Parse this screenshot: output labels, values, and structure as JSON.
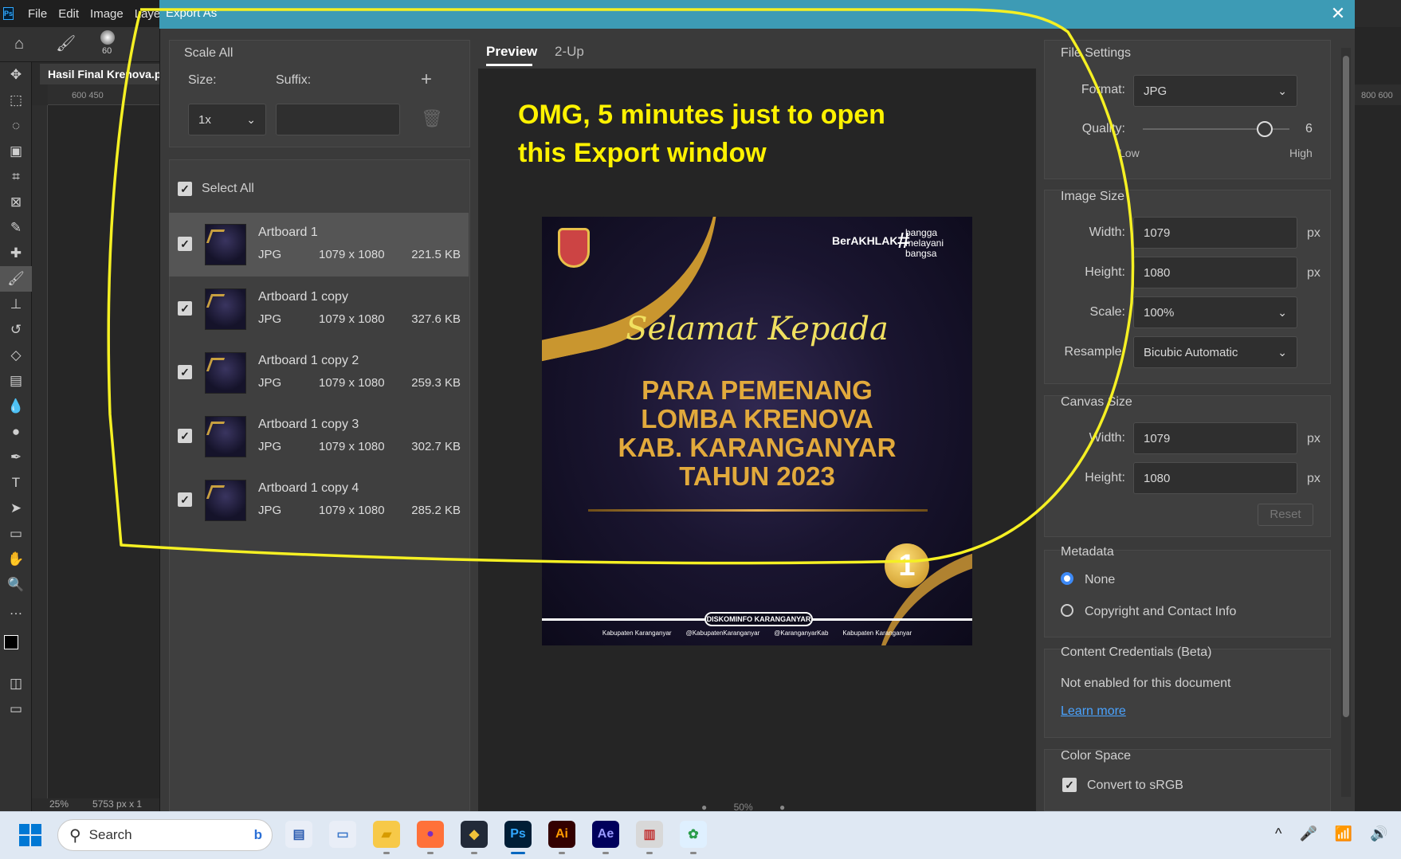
{
  "ps": {
    "logo": "Ps",
    "menu": [
      "File",
      "Edit",
      "Image",
      "Laye"
    ],
    "brush_size": "60",
    "doc_tab": "Hasil Final Krenova.ps",
    "ruler_top": "600      450",
    "ruler_right": "800  600",
    "status_zoom": "25%",
    "status_dims": "5753 px x 1"
  },
  "dialog": {
    "title": "Export As",
    "close_icon": "close-icon"
  },
  "scale": {
    "title": "Scale All",
    "size_label": "Size:",
    "suffix_label": "Suffix:",
    "size_value": "1x",
    "suffix_value": "",
    "add_icon": "plus-icon",
    "delete_icon": "trash-icon"
  },
  "assets": {
    "select_all": "Select All",
    "rows": [
      {
        "name": "Artboard 1",
        "format": "JPG",
        "dims": "1079 x 1080",
        "size": "221.5 KB",
        "selected": true
      },
      {
        "name": "Artboard 1 copy",
        "format": "JPG",
        "dims": "1079 x 1080",
        "size": "327.6 KB",
        "selected": false
      },
      {
        "name": "Artboard 1 copy 2",
        "format": "JPG",
        "dims": "1079 x 1080",
        "size": "259.3 KB",
        "selected": false
      },
      {
        "name": "Artboard 1 copy 3",
        "format": "JPG",
        "dims": "1079 x 1080",
        "size": "302.7 KB",
        "selected": false
      },
      {
        "name": "Artboard 1 copy 4",
        "format": "JPG",
        "dims": "1079 x 1080",
        "size": "285.2 KB",
        "selected": false
      }
    ]
  },
  "preview": {
    "tabs": [
      "Preview",
      "2-Up"
    ],
    "annotation": "OMG, 5 minutes just to open this Export window",
    "zoom": "50%"
  },
  "poster": {
    "berakhlak": "BerAKHLAK",
    "hash": "#",
    "bangga": "bangga melayani bangsa",
    "script": "Selamat Kepada",
    "headline": [
      "PARA PEMENANG",
      "LOMBA KRENOVA",
      "KAB. KARANGANYAR",
      "TAHUN 2023"
    ],
    "medal": "1",
    "badge": "DISKOMINFO KARANGANYAR",
    "socials": [
      "Kabupaten Karanganyar",
      "@KabupatenKaranganyar",
      "@KaranganyarKab",
      "Kabupaten Karanganyar"
    ]
  },
  "file_settings": {
    "title": "File Settings",
    "format_label": "Format:",
    "format_value": "JPG",
    "quality_label": "Quality:",
    "quality_value": "6",
    "quality_fraction": 0.83,
    "low": "Low",
    "high": "High"
  },
  "image_size": {
    "title": "Image Size",
    "width_label": "Width:",
    "width_value": "1079",
    "height_label": "Height:",
    "height_value": "1080",
    "scale_label": "Scale:",
    "scale_value": "100%",
    "resample_label": "Resample:",
    "resample_value": "Bicubic Automatic",
    "unit": "px"
  },
  "canvas_size": {
    "title": "Canvas Size",
    "width_label": "Width:",
    "width_value": "1079",
    "height_label": "Height:",
    "height_value": "1080",
    "unit": "px",
    "reset": "Reset"
  },
  "metadata": {
    "title": "Metadata",
    "none": "None",
    "copyright": "Copyright and Contact Info"
  },
  "credentials": {
    "title": "Content Credentials (Beta)",
    "text": "Not enabled for this document",
    "link": "Learn more"
  },
  "color_space": {
    "title": "Color Space",
    "convert": "Convert to sRGB"
  },
  "taskbar": {
    "search": "Search",
    "apps": [
      {
        "name": "explorer-doc-icon",
        "glyph": "▤",
        "bg": "#e9eef7",
        "fg": "#2a5bb0"
      },
      {
        "name": "photos-icon",
        "glyph": "▭",
        "bg": "#e9eef7",
        "fg": "#3a77c9"
      },
      {
        "name": "file-explorer-icon",
        "glyph": "▰",
        "bg": "#f7c948",
        "fg": "#d79b00"
      },
      {
        "name": "firefox-icon",
        "glyph": "●",
        "bg": "#ff7139",
        "fg": "#7b2cbf"
      },
      {
        "name": "davinci-icon",
        "glyph": "◆",
        "bg": "#222a38",
        "fg": "#f0c23a"
      },
      {
        "name": "photoshop-icon",
        "glyph": "Ps",
        "bg": "#001e36",
        "fg": "#31a8ff"
      },
      {
        "name": "illustrator-icon",
        "glyph": "Ai",
        "bg": "#330000",
        "fg": "#ff9a00"
      },
      {
        "name": "after-effects-icon",
        "glyph": "Ae",
        "bg": "#00005b",
        "fg": "#9999ff"
      },
      {
        "name": "drive-tool-icon",
        "glyph": "▥",
        "bg": "#d8d8d8",
        "fg": "#c03030"
      },
      {
        "name": "network-tool-icon",
        "glyph": "✿",
        "bg": "#dff0ff",
        "fg": "#2a9d4a"
      }
    ],
    "tray": [
      "^",
      "🎤",
      "📶",
      "🔊"
    ]
  }
}
